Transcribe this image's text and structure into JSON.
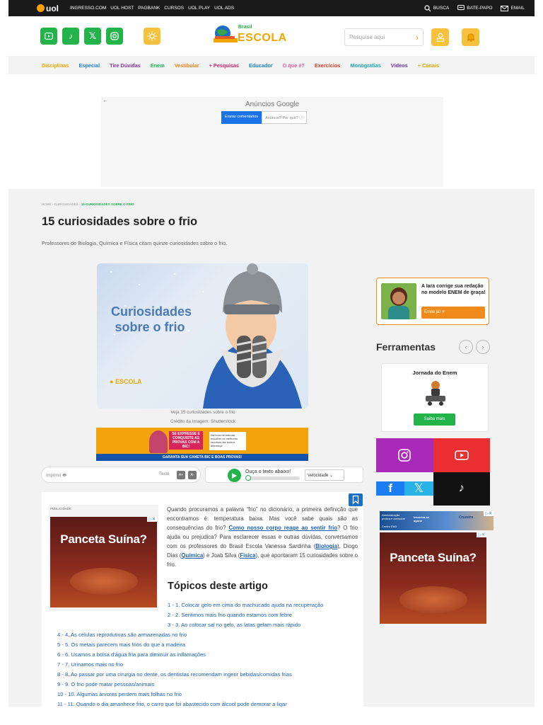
{
  "uol": {
    "logo": "uol",
    "nav": [
      "INGRESSO.COM",
      "UOL HOST",
      "PAGBANK",
      "CURSOS",
      "UOL PLAY",
      "UOL ADS"
    ],
    "busca": "BUSCA",
    "batepapo": "BATE-PAPO",
    "email": "EMAIL"
  },
  "brand": {
    "line1": "Brasil",
    "line2": "ESCOLA"
  },
  "search": {
    "placeholder": "Pesquise aqui"
  },
  "categories": [
    {
      "label": "Disciplinas",
      "color": "#f0a500"
    },
    {
      "label": "Especial",
      "color": "#1d7ec7"
    },
    {
      "label": "Tire Dúvidas",
      "color": "#8c2fa8"
    },
    {
      "label": "Enem",
      "color": "#22b34a"
    },
    {
      "label": "Vestibular",
      "color": "#e8861a"
    },
    {
      "label": "+ Pesquisas",
      "color": "#c4246d"
    },
    {
      "label": "Educador",
      "color": "#1d7ec7"
    },
    {
      "label": "O que é?",
      "color": "#e85a9a"
    },
    {
      "label": "Exercícios",
      "color": "#d33a2c"
    },
    {
      "label": "Monografias",
      "color": "#1ba5b0"
    },
    {
      "label": "Vídeos",
      "color": "#6a2fa8"
    },
    {
      "label": "+ Canais",
      "color": "#e0a800"
    }
  ],
  "ad_top": {
    "title": "Anúncios Google",
    "btn1": "Enviar comentários",
    "btn2": "Anúncio? Por quê? ⓘ"
  },
  "breadcrumb": {
    "home": "HOME",
    "sep": "›",
    "section": "CURIOSIDADES",
    "current": "15 CURIOSIDADES SOBRE O FRIO"
  },
  "article": {
    "title": "15 curiosidades sobre o frio",
    "lead": "Professores de Biologia, Química e Física citam quinze curiosidades sobre o frio.",
    "hero_line1": "Curiosidades",
    "hero_line2": "sobre o frio",
    "caption1": "Veja 15 curiosidades sobre o frio",
    "caption2": "Crédito da Imagem: Shutterstock",
    "banner_tagline": "SE EXPRESSE E CONQUISTE AS PROVAS COM A BIC!",
    "banner_box": "Na hora de estudar, escolher os melhores recursos faz toda a diferença",
    "banner_footer": "GARANTA SUA CANETA BIC E BOAS PROVAS!",
    "imprimir": "Imprimir",
    "texto": "Texto",
    "font_up": "A+",
    "font_down": "A-",
    "audio_label": "Ouça o texto abaixo!",
    "velocidade": "Velocidade",
    "pub_label": "PUBLICIDADE",
    "pub_ad": "Panceta Suína?",
    "p_1": "Quando procuramos a palavra “frio” no dicionário, a primeira definição que encontramos é: temperatura baixa. Mas você sabe quais são as consequências do frio? ",
    "link1": "Como nosso corpo reage ao sentir frio",
    "p_2": "? O frio ajuda ou prejudica? Para esclarecer essas e outras dúvidas, conversamos com os professores do Brasil Escola Vanessa Sardinha (",
    "l_bio": "Biologia",
    "p_3": "), Diogo Dias (",
    "l_qui": "Química",
    "p_4": ") e Joab Silva (",
    "l_fis": "Física",
    "p_5": "), que apontaram 15 curiosidades sobre o frio.",
    "topics_title": "Tópicos deste artigo",
    "topics": [
      "1 - 1. Colocar gelo em cima do machucado ajuda na recuperação",
      "2 - 2. Sentimos mais frio quando estamos com febre",
      "3 - 3. Ao colocar sal no gelo, as latas gelam mais rápido",
      "4 - 4. As células reprodutivas são armazenadas no frio",
      "5 - 5. Os metais parecem mais frios do que a madeira",
      "6 - 6. Usamos a bolsa d'água fria para diminuir as inflamações",
      "7 - 7. Urinamos mais no frio",
      "8 - 8. Ao passar por uma cirurgia no dente, os dentistas recomendam ingerir bebidas/comidas frias",
      "9 - 9. O frio pode matar pessoas/animais",
      "10 - 10. Algumas árvores perdem mais folhas no frio",
      "11 - 11. Quando o dia amanhece frio, o carro que foi abastecido com álcool pode demorar a ligar"
    ]
  },
  "sidebar": {
    "iara_text": "A Iara corrige sua redação no modelo ENEM de graça!",
    "iara_btn": "Envie já!",
    "ferramentas": "Ferramentas",
    "enem_title": "Jornada do Enem",
    "enem_btn": "Saiba mais",
    "ad_small_a": "Administração prática e acessível",
    "ad_small_b": "Inscreva-se agora!",
    "ad_small_c": "Cruzeiro",
    "ad_small_d": "Centro EAD",
    "ad_big": "Panceta Suína?"
  }
}
